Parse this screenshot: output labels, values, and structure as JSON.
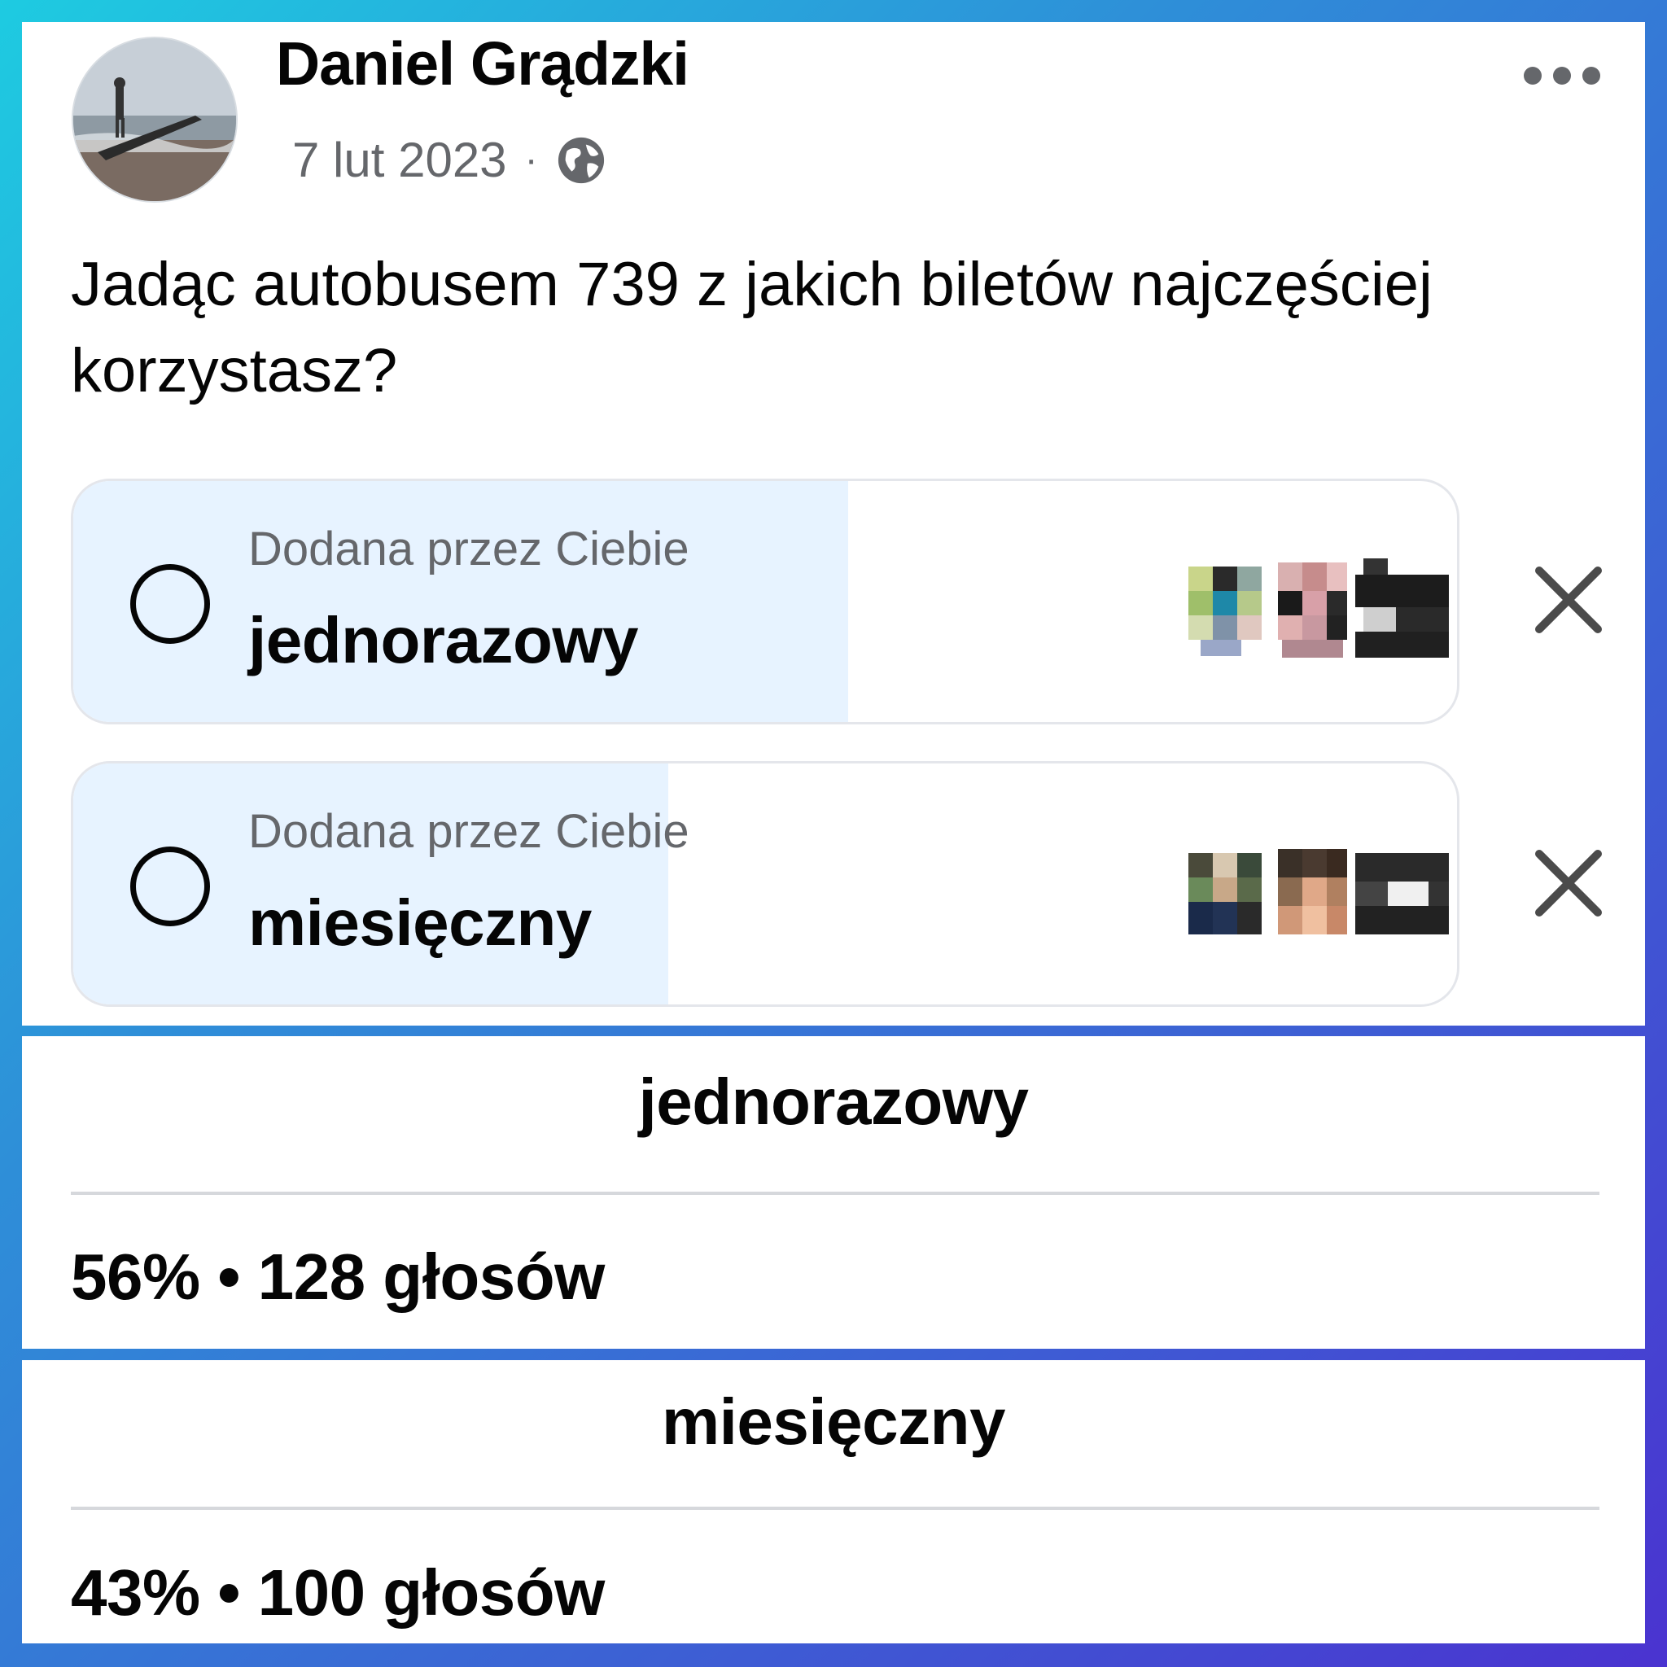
{
  "post": {
    "author": "Daniel Grądzki",
    "date": "7 lut 2023",
    "separator": "·",
    "privacy_icon": "globe-icon",
    "more_icon": "more-horizontal-icon",
    "text": "Jadąc autobusem 739 z jakich biletów najczęściej korzystasz?"
  },
  "poll": {
    "options": [
      {
        "added_by": "Dodana przez Ciebie",
        "label": "jednorazowy",
        "share": 0.56
      },
      {
        "added_by": "Dodana przez Ciebie",
        "label": "miesięczny",
        "share": 0.43
      }
    ]
  },
  "results": [
    {
      "title": "jednorazowy",
      "stats": "56% • 128 głosów"
    },
    {
      "title": "miesięczny",
      "stats": "43% • 100 głosów"
    }
  ],
  "colors": {
    "poll_fill": "#e7f3ff",
    "secondary_text": "#65676b",
    "accent_blue": "#3d5fd4"
  }
}
